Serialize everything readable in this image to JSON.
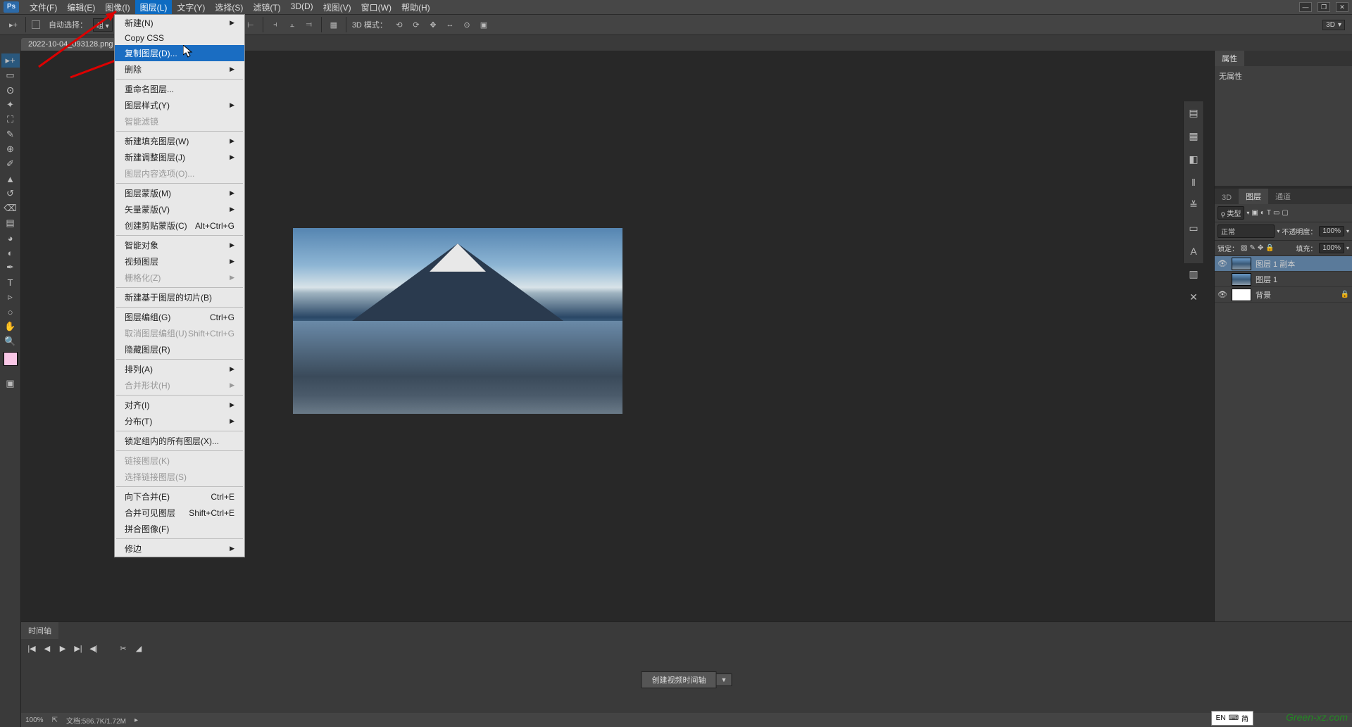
{
  "app": {
    "logo": "Ps"
  },
  "menubar": [
    "文件(F)",
    "编辑(E)",
    "图像(I)",
    "图层(L)",
    "文字(Y)",
    "选择(S)",
    "滤镜(T)",
    "3D(D)",
    "视图(V)",
    "窗口(W)",
    "帮助(H)"
  ],
  "menubar_open_index": 3,
  "dropdown": [
    {
      "label": "新建(N)",
      "arrow": true
    },
    {
      "label": "Copy CSS"
    },
    {
      "label": "复制图层(D)...",
      "highlight": true
    },
    {
      "label": "删除",
      "arrow": true
    },
    {
      "sep": true
    },
    {
      "label": "重命名图层..."
    },
    {
      "label": "图层样式(Y)",
      "arrow": true
    },
    {
      "label": "智能滤镜",
      "disabled": true
    },
    {
      "sep": true
    },
    {
      "label": "新建填充图层(W)",
      "arrow": true
    },
    {
      "label": "新建调整图层(J)",
      "arrow": true
    },
    {
      "label": "图层内容选项(O)...",
      "disabled": true
    },
    {
      "sep": true
    },
    {
      "label": "图层蒙版(M)",
      "arrow": true
    },
    {
      "label": "矢量蒙版(V)",
      "arrow": true
    },
    {
      "label": "创建剪贴蒙版(C)",
      "shortcut": "Alt+Ctrl+G"
    },
    {
      "sep": true
    },
    {
      "label": "智能对象",
      "arrow": true
    },
    {
      "label": "视频图层",
      "arrow": true
    },
    {
      "label": "栅格化(Z)",
      "disabled": true,
      "arrow": true
    },
    {
      "sep": true
    },
    {
      "label": "新建基于图层的切片(B)"
    },
    {
      "sep": true
    },
    {
      "label": "图层编组(G)",
      "shortcut": "Ctrl+G"
    },
    {
      "label": "取消图层编组(U)",
      "shortcut": "Shift+Ctrl+G",
      "disabled": true
    },
    {
      "label": "隐藏图层(R)"
    },
    {
      "sep": true
    },
    {
      "label": "排列(A)",
      "arrow": true
    },
    {
      "label": "合并形状(H)",
      "disabled": true,
      "arrow": true
    },
    {
      "sep": true
    },
    {
      "label": "对齐(I)",
      "arrow": true
    },
    {
      "label": "分布(T)",
      "arrow": true
    },
    {
      "sep": true
    },
    {
      "label": "锁定组内的所有图层(X)..."
    },
    {
      "sep": true
    },
    {
      "label": "链接图层(K)",
      "disabled": true
    },
    {
      "label": "选择链接图层(S)",
      "disabled": true
    },
    {
      "sep": true
    },
    {
      "label": "向下合并(E)",
      "shortcut": "Ctrl+E"
    },
    {
      "label": "合并可见图层",
      "shortcut": "Shift+Ctrl+E"
    },
    {
      "label": "拼合图像(F)"
    },
    {
      "sep": true
    },
    {
      "label": "修边",
      "arrow": true
    }
  ],
  "optionsbar": {
    "auto_select_label": "自动选择：",
    "mode_3d_label": "3D 模式：",
    "right_combo": "3D"
  },
  "doc_tab": {
    "title": "2022-10-04_093128.png @",
    "close": "×"
  },
  "properties": {
    "tab": "属性",
    "empty": "无属性"
  },
  "layers_tabs": {
    "tab_3d": "3D",
    "tab_layers": "图层",
    "tab_channels": "通道"
  },
  "layers_ctrl": {
    "filter": "ϙ 类型",
    "blend": "正常",
    "opacity_label": "不透明度：",
    "opacity_val": "100%",
    "lock_label": "锁定：",
    "fill_label": "填充：",
    "fill_val": "100%"
  },
  "layers": [
    {
      "name": "图层 1 副本",
      "visible": true,
      "selected": true
    },
    {
      "name": "图层 1",
      "visible": false
    },
    {
      "name": "背景",
      "visible": true,
      "locked": true
    }
  ],
  "timeline": {
    "tab": "时间轴",
    "create": "创建视频时间轴"
  },
  "status": {
    "zoom": "100%",
    "doc": "文档:586.7K/1.72M",
    "arrow": "▸"
  },
  "ime": {
    "lang": "EN",
    "kb": "⌨",
    "cn": "简"
  },
  "watermark": "Green-xz.com"
}
